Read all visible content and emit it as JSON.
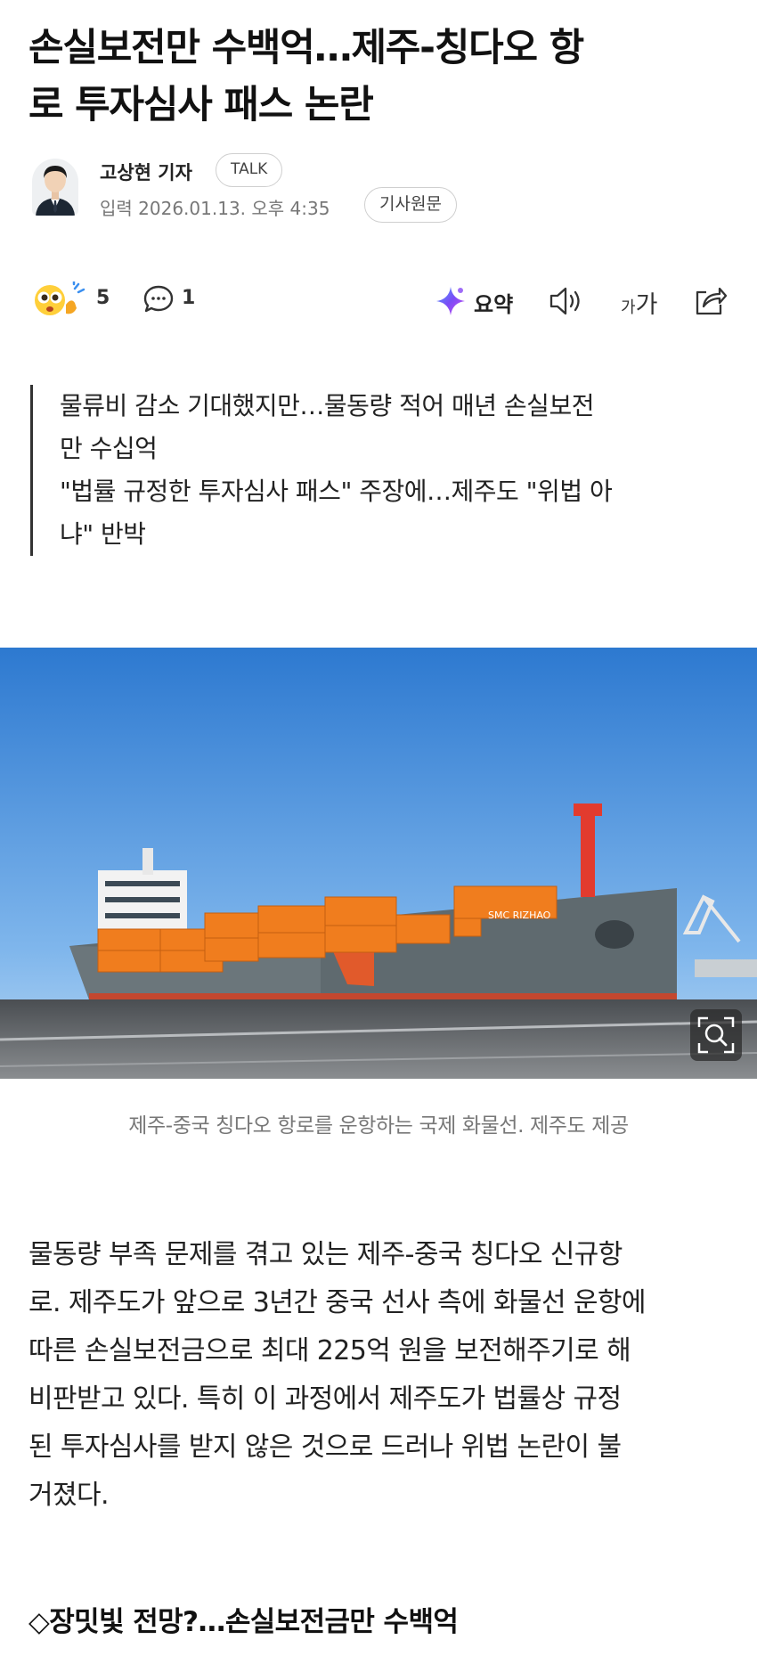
{
  "article": {
    "headline_line1": "손실보전만 수백억…제주-칭다오 항",
    "headline_line2": "로 투자심사 패스 논란",
    "author": "고상현 기자",
    "talk_label": "TALK",
    "date": "입력 2026.01.13. 오후 4:35",
    "source_label": "기사원문"
  },
  "actions": {
    "reaction_count": "5",
    "comment_count": "1",
    "summary_label": "요약",
    "font_small": "가",
    "font_big": "가",
    "icons": [
      "reaction-emoji-icon",
      "comment-icon",
      "summary-sparkle-icon",
      "speaker-icon",
      "font-size-icon",
      "share-icon"
    ]
  },
  "summary": {
    "lines": [
      "물류비 감소 기대했지만…물동량 적어 매년 손실보전",
      "만 수십억",
      "\"법률 규정한 투자심사 패스\" 주장에…제주도 \"위법 아",
      "냐\" 반박"
    ]
  },
  "photo": {
    "ship_name": "SMC RIZHAO",
    "caption": "제주-중국 칭다오 항로를 운항하는 국제 화물선. 제주도 제공"
  },
  "body": {
    "lines": [
      "물동량 부족 문제를 겪고 있는 제주-중국 칭다오 신규항",
      "로. 제주도가 앞으로 3년간 중국 선사 측에 화물선 운항에",
      "따른 손실보전금으로 최대 225억 원을 보전해주기로 해",
      "비판받고 있다. 특히 이 과정에서 제주도가 법률상 규정",
      "된 투자심사를 받지 않은 것으로 드러나 위법 논란이 불",
      "거졌다."
    ],
    "subheading": "◇장밋빛 전망?…손실보전금만 수백억"
  },
  "colors": {
    "accent_purple": "#6b4cf6",
    "ship_orange": "#f07d1e",
    "ship_hull": "#5f6a6f",
    "sky": "#2f7fd3"
  }
}
